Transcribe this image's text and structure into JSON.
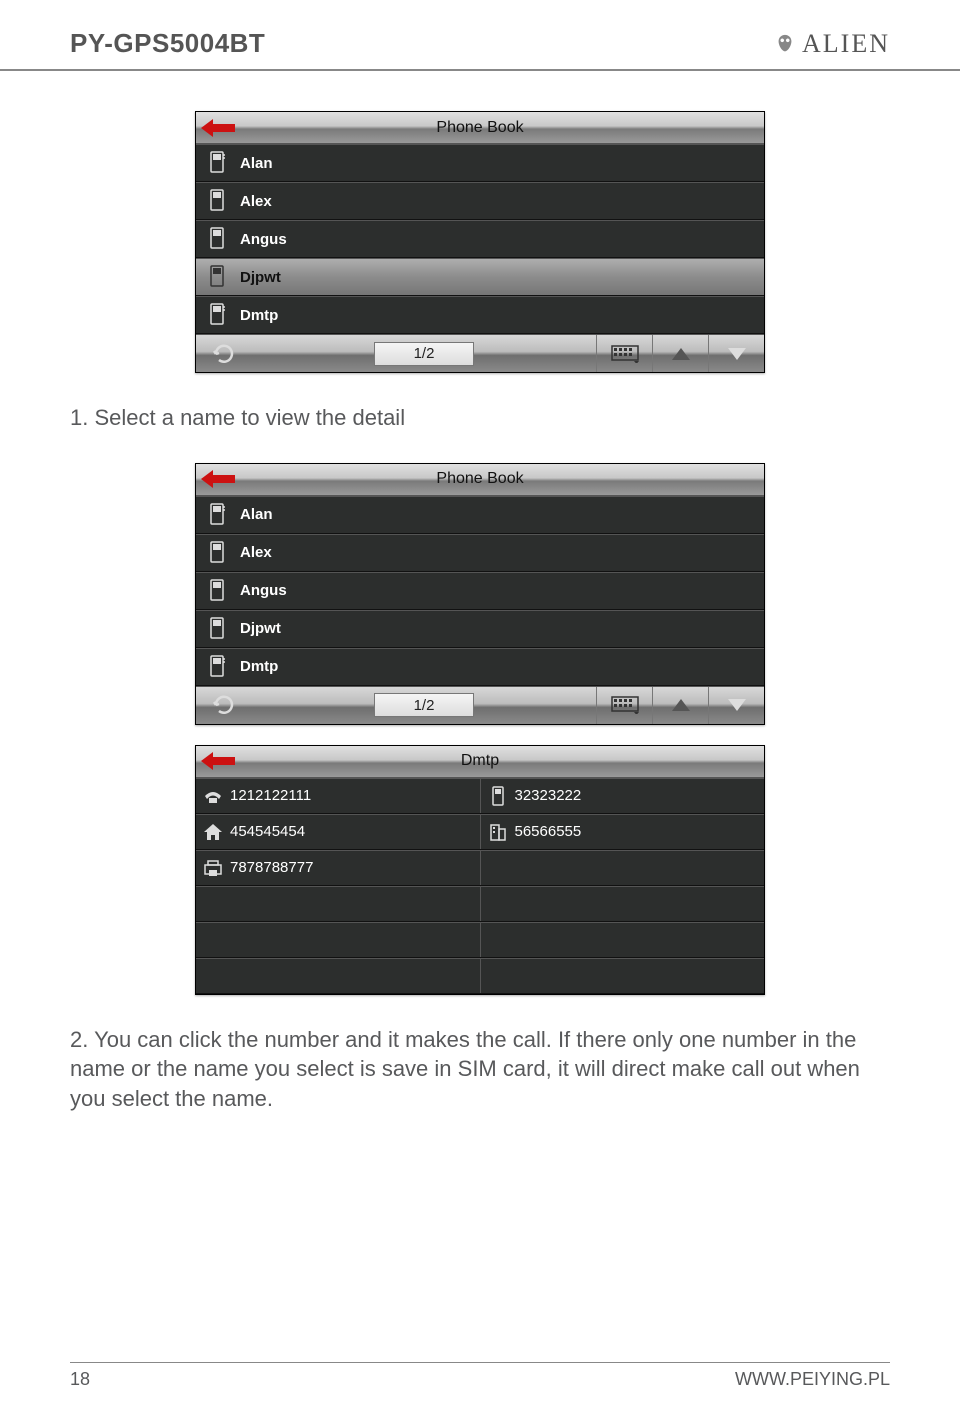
{
  "header": {
    "model": "PY-GPS5004BT",
    "brand": "ALIEN"
  },
  "screenshot1": {
    "title": "Phone Book",
    "contacts": [
      "Alan",
      "Alex",
      "Angus",
      "Djpwt",
      "Dmtp"
    ],
    "selected_index": 3,
    "page": "1/2"
  },
  "text_step1": "1. Select a name to view the detail",
  "screenshot2": {
    "title": "Phone Book",
    "contacts": [
      "Alan",
      "Alex",
      "Angus",
      "Djpwt",
      "Dmtp"
    ],
    "page": "1/2"
  },
  "screenshot3": {
    "title": "Dmtp",
    "entries": {
      "phone": "1212122111",
      "mobile": "32323222",
      "home": "454545454",
      "office": "56566555",
      "fax": "7878788777"
    }
  },
  "text_step2": "2. You can click the number and it makes the call. If there only one number in the name or the name you select is save in SIM card, it will direct make call out when you select the name.",
  "footer": {
    "page_number": "18",
    "url": "WWW.PEIYING.PL"
  }
}
